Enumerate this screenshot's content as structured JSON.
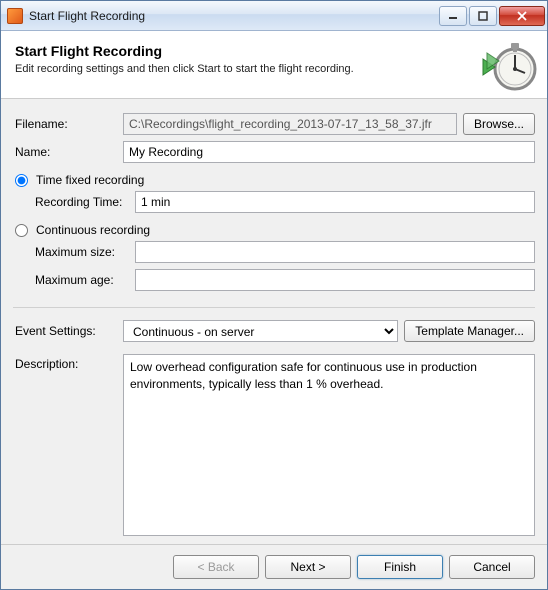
{
  "window": {
    "title": "Start Flight Recording"
  },
  "header": {
    "title": "Start Flight Recording",
    "subtitle": "Edit recording settings and then click Start to start the flight recording."
  },
  "form": {
    "filename_label": "Filename:",
    "filename_value": "C:\\Recordings\\flight_recording_2013-07-17_13_58_37.jfr",
    "browse_label": "Browse...",
    "name_label": "Name:",
    "name_value": "My Recording",
    "radio_time_fixed_label": "Time fixed recording",
    "recording_time_label": "Recording Time:",
    "recording_time_value": "1 min",
    "radio_continuous_label": "Continuous recording",
    "max_size_label": "Maximum size:",
    "max_size_value": "",
    "max_age_label": "Maximum age:",
    "max_age_value": "",
    "event_settings_label": "Event Settings:",
    "event_settings_value": "Continuous - on server",
    "template_manager_label": "Template Manager...",
    "description_label": "Description:",
    "description_value": "Low overhead configuration safe for continuous use in production environments, typically less than 1 % overhead."
  },
  "footer": {
    "back_label": "< Back",
    "next_label": "Next >",
    "finish_label": "Finish",
    "cancel_label": "Cancel"
  }
}
